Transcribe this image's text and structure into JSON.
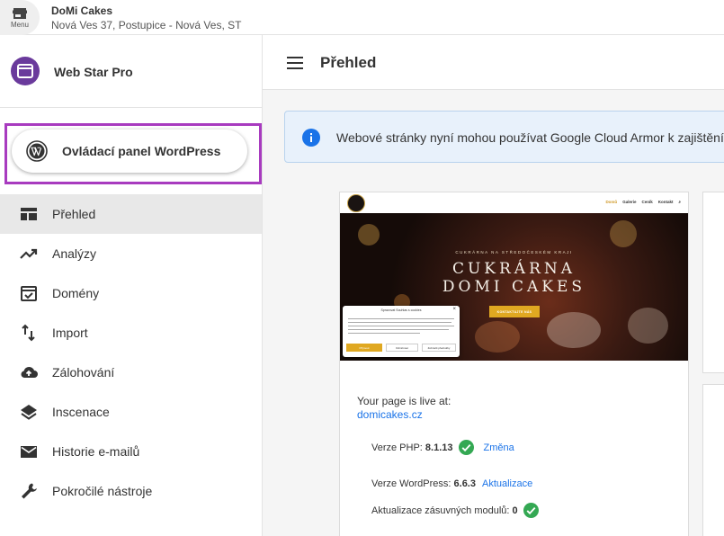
{
  "topbar": {
    "menu_label": "Menu",
    "business_name": "DoMi Cakes",
    "business_address": "Nová Ves 37, Postupice - Nová Ves, ST"
  },
  "sidebar": {
    "app_name": "Web Star Pro",
    "wordpress_button": "Ovládací panel WordPress",
    "items": [
      {
        "label": "Přehled",
        "icon": "dashboard-icon",
        "active": true
      },
      {
        "label": "Analýzy",
        "icon": "trending-up-icon"
      },
      {
        "label": "Domény",
        "icon": "calendar-check-icon"
      },
      {
        "label": "Import",
        "icon": "import-arrows-icon"
      },
      {
        "label": "Zálohování",
        "icon": "cloud-upload-icon"
      },
      {
        "label": "Inscenace",
        "icon": "layers-icon"
      },
      {
        "label": "Historie e-mailů",
        "icon": "email-icon"
      },
      {
        "label": "Pokročilé nástroje",
        "icon": "wrench-icon"
      }
    ]
  },
  "main": {
    "title": "Přehled",
    "info_banner": "Webové stránky nyní mohou používat Google Cloud Armor k zajištění",
    "preview": {
      "nav_links": [
        "Domů",
        "Galerie",
        "Ceník",
        "Kontakt"
      ],
      "subtitle": "CUKRÁRNA NA STŘEDOČESKÉM KRAJI",
      "title_line1": "CUKRÁRNA",
      "title_line2": "DOMI CAKES",
      "cta": "KONTAKTUJTE NÁS",
      "cookie_title": "Spravovat Souhlas s cookies",
      "cookie_accept": "Přijmout",
      "cookie_reject": "Odmítnout",
      "cookie_prefs": "Zobrazit předvolby"
    },
    "live_label": "Your page is live at:",
    "live_url": "domicakes.cz",
    "php_label": "Verze PHP:",
    "php_version": "8.1.13",
    "php_action": "Změna",
    "wp_label": "Verze WordPress:",
    "wp_version": "6.6.3",
    "wp_action": "Aktualizace",
    "plugins_label": "Aktualizace zásuvných modulů:",
    "plugins_count": "0"
  },
  "colors": {
    "accent_purple": "#a83bbf",
    "link_blue": "#1a73e8",
    "success_green": "#34a853",
    "info_blue": "#1a73e8"
  }
}
